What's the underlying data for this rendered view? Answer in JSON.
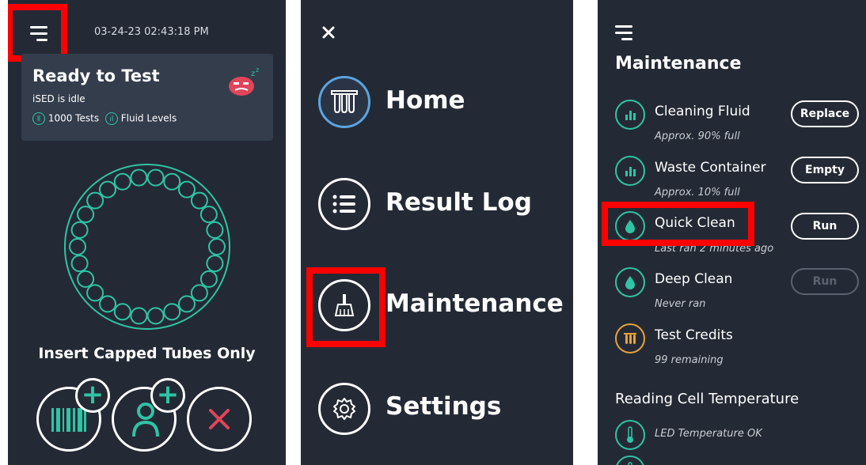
{
  "home": {
    "timestamp": "03-24-23 02:43:18 PM",
    "status_title": "Ready to Test",
    "status_sub": "iSED is idle",
    "tests_label": "1000 Tests",
    "fluid_label": "Fluid Levels",
    "instruction": "Insert Capped Tubes Only",
    "colors": {
      "accent": "#2ec4a5",
      "background": "#242a35",
      "card": "#333d4c",
      "cancel": "#e0455a"
    }
  },
  "menu": {
    "items": [
      {
        "label": "Home",
        "icon": "tubes-icon"
      },
      {
        "label": "Result Log",
        "icon": "list-icon"
      },
      {
        "label": "Maintenance",
        "icon": "broom-icon"
      },
      {
        "label": "Settings",
        "icon": "gear-icon"
      }
    ]
  },
  "maintenance": {
    "title": "Maintenance",
    "items": [
      {
        "title": "Cleaning Fluid",
        "subtitle": "Approx. 90% full",
        "button": "Replace",
        "icon": "level-icon"
      },
      {
        "title": "Waste Container",
        "subtitle": "Approx. 10% full",
        "button": "Empty",
        "icon": "level-icon"
      },
      {
        "title": "Quick Clean",
        "subtitle": "Last ran 2 minutes ago",
        "button": "Run",
        "icon": "drop-icon"
      },
      {
        "title": "Deep Clean",
        "subtitle": "Never ran",
        "button": "Run",
        "icon": "drop-icon"
      },
      {
        "title": "Test Credits",
        "subtitle": "99 remaining",
        "icon": "tubes-icon"
      }
    ],
    "temp_heading": "Reading Cell Temperature",
    "temp_status": "LED Temperature OK"
  }
}
